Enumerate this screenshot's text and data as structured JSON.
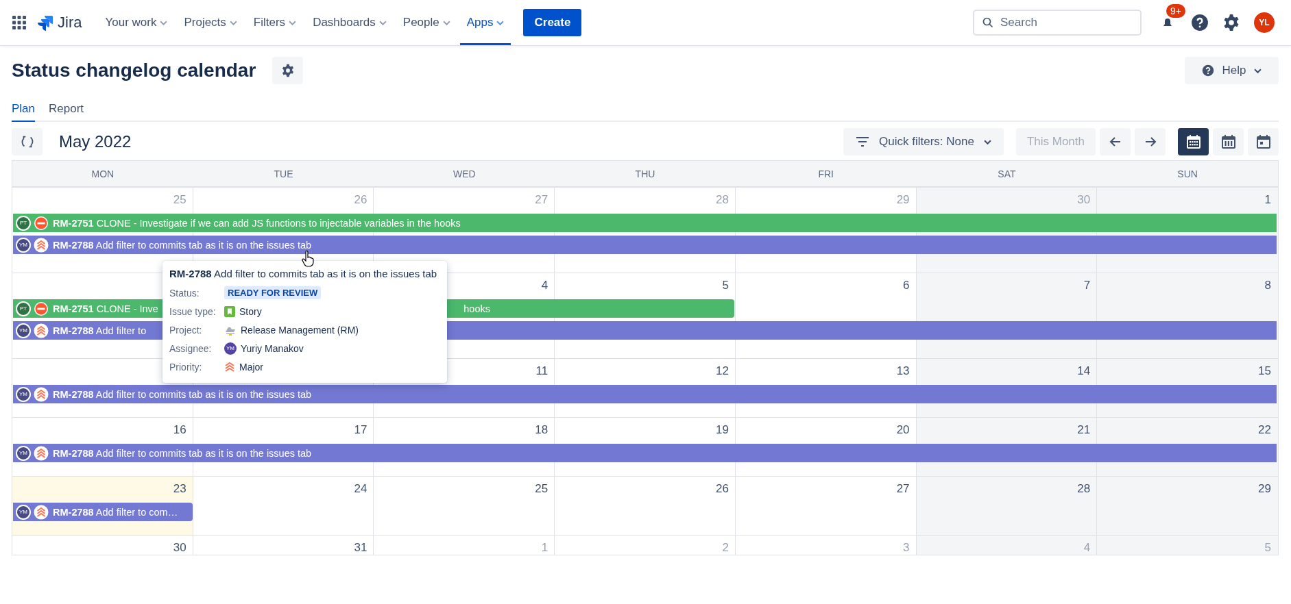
{
  "topnav": {
    "logo": "Jira",
    "items": [
      {
        "label": "Your work",
        "selected": false
      },
      {
        "label": "Projects",
        "selected": false
      },
      {
        "label": "Filters",
        "selected": false
      },
      {
        "label": "Dashboards",
        "selected": false
      },
      {
        "label": "People",
        "selected": false
      },
      {
        "label": "Apps",
        "selected": true
      }
    ],
    "create": "Create",
    "search": {
      "placeholder": "Search"
    },
    "notifications": "9+",
    "avatar": "YL"
  },
  "page": {
    "title": "Status changelog calendar",
    "help": "Help",
    "tabs": [
      {
        "label": "Plan",
        "selected": true
      },
      {
        "label": "Report",
        "selected": false
      }
    ]
  },
  "toolbar": {
    "month": "May 2022",
    "quick_filters": "Quick filters: None",
    "this_month": {
      "label": "This Month",
      "disabled": true
    },
    "views": [
      {
        "kind": "month",
        "selected": true
      },
      {
        "kind": "week",
        "selected": false
      },
      {
        "kind": "day",
        "selected": false
      }
    ]
  },
  "calendar": {
    "weekdays": [
      "MON",
      "TUE",
      "WED",
      "THU",
      "FRI",
      "SAT",
      "SUN"
    ],
    "weeks": [
      {
        "days": [
          {
            "date": "25",
            "muted": true,
            "today": false
          },
          {
            "date": "26",
            "muted": true,
            "today": false
          },
          {
            "date": "27",
            "muted": true,
            "today": false
          },
          {
            "date": "28",
            "muted": true,
            "today": false
          },
          {
            "date": "29",
            "muted": true,
            "today": false
          },
          {
            "date": "30",
            "muted": true,
            "today": false
          },
          {
            "date": "1",
            "muted": false,
            "today": false
          }
        ],
        "events": [
          {
            "key": "RM-2751",
            "title": "CLONE - Investigate if we can add JS functions to injectable variables in the hooks",
            "assignee": "PT",
            "kind": "blocker",
            "color": "#4bb86c",
            "level": 1
          },
          {
            "key": "RM-2788",
            "title": "Add filter to commits tab as it is on the issues tab",
            "assignee": "YM",
            "kind": "major",
            "color": "#7378d3",
            "level": 1
          }
        ]
      },
      {
        "days": [
          {
            "date": "4",
            "muted": false,
            "today": false
          },
          {
            "date": "5",
            "muted": false,
            "today": false
          },
          {
            "date": "6",
            "muted": false,
            "today": false
          },
          {
            "date": "7",
            "muted": false,
            "today": false
          },
          {
            "date": "8",
            "muted": false,
            "today": false
          }
        ],
        "events": [
          {
            "key": "RM-2751",
            "title": "CLONE - Inve",
            "tail": "hooks",
            "assignee": "PT",
            "kind": "blocker",
            "color": "#4bb86c",
            "level": 0.5714
          },
          {
            "key": "RM-2788",
            "title": "Add filter to",
            "assignee": "YM",
            "kind": "major",
            "color": "#7378d3",
            "level": 1
          }
        ]
      },
      {
        "days": [
          {
            "date": "11",
            "muted": false,
            "today": false
          },
          {
            "date": "12",
            "muted": false,
            "today": false
          },
          {
            "date": "13",
            "muted": false,
            "today": false
          },
          {
            "date": "14",
            "muted": false,
            "today": false
          },
          {
            "date": "15",
            "muted": false,
            "today": false
          }
        ],
        "events": [
          {
            "key": "RM-2788",
            "title": "Add filter to commits tab as it is on the issues tab",
            "assignee": "YM",
            "kind": "major",
            "color": "#7378d3",
            "level": 1
          }
        ]
      },
      {
        "days": [
          {
            "date": "16",
            "muted": false,
            "today": false
          },
          {
            "date": "17",
            "muted": false,
            "today": false
          },
          {
            "date": "18",
            "muted": false,
            "today": false
          },
          {
            "date": "19",
            "muted": false,
            "today": false
          },
          {
            "date": "20",
            "muted": false,
            "today": false
          },
          {
            "date": "21",
            "muted": false,
            "today": false
          },
          {
            "date": "22",
            "muted": false,
            "today": false
          }
        ],
        "events": [
          {
            "key": "RM-2788",
            "title": "Add filter to commits tab as it is on the issues tab",
            "assignee": "YM",
            "kind": "major",
            "color": "#7378d3",
            "level": 1
          }
        ]
      },
      {
        "days": [
          {
            "date": "23",
            "muted": false,
            "today": true
          },
          {
            "date": "24",
            "muted": false,
            "today": false
          },
          {
            "date": "25",
            "muted": false,
            "today": false
          },
          {
            "date": "26",
            "muted": false,
            "today": false
          },
          {
            "date": "27",
            "muted": false,
            "today": false
          },
          {
            "date": "28",
            "muted": false,
            "today": false
          },
          {
            "date": "29",
            "muted": false,
            "today": false
          }
        ],
        "events": [
          {
            "key": "RM-2788",
            "title": "Add filter to com…",
            "assignee": "YM",
            "kind": "major",
            "color": "#7378d3",
            "level": 0.1429
          }
        ]
      },
      {
        "days": [
          {
            "date": "30",
            "muted": false,
            "today": false
          },
          {
            "date": "31",
            "muted": false,
            "today": false
          },
          {
            "date": "1",
            "muted": true,
            "today": false
          },
          {
            "date": "2",
            "muted": true,
            "today": false
          },
          {
            "date": "3",
            "muted": true,
            "today": false
          },
          {
            "date": "4",
            "muted": true,
            "today": false
          },
          {
            "date": "5",
            "muted": true,
            "today": false
          }
        ]
      }
    ],
    "tooltip": {
      "key": "RM-2788",
      "title": "Add filter to commits tab as it is on the issues tab",
      "fields": [
        {
          "label": "Status:",
          "kind": "status",
          "value": "READY FOR REVIEW"
        },
        {
          "label": "Issue type:",
          "kind": "type",
          "value": "Story"
        },
        {
          "label": "Project:",
          "kind": "project",
          "value": "Release Management (RM)"
        },
        {
          "label": "Assignee:",
          "kind": "assignee",
          "value": "Yuriy Manakov",
          "initials": "YM"
        },
        {
          "label": "Priority:",
          "kind": "priority",
          "value": "Major"
        }
      ]
    }
  }
}
